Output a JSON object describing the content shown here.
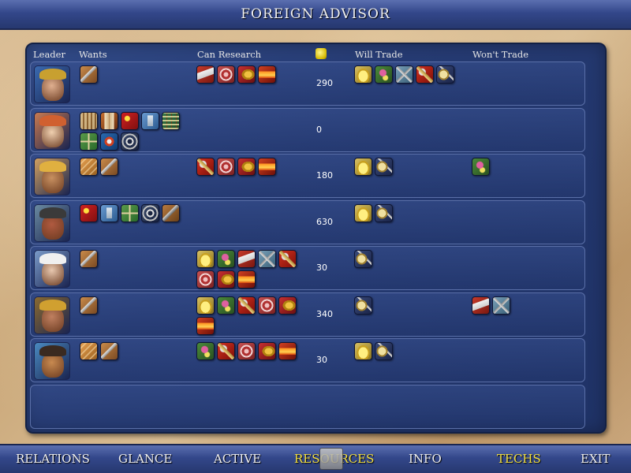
{
  "title": "FOREIGN ADVISOR",
  "headers": {
    "leader": "Leader",
    "wants": "Wants",
    "can_research": "Can Research",
    "will_trade": "Will Trade",
    "wont_trade": "Won't Trade"
  },
  "rows": [
    {
      "gold": "290",
      "leader_colors": {
        "bg": "#3a6ab0",
        "face": "#e0b090",
        "hat": "#c8a030"
      },
      "wants": [
        "sword"
      ],
      "can_research": [
        "tools-scroll",
        "target",
        "horn",
        "fire"
      ],
      "will_trade": [
        "crown",
        "flower",
        "tools",
        "hammer",
        "compass"
      ],
      "wont_trade": []
    },
    {
      "gold": "0",
      "leader_colors": {
        "bg": "#c87a50",
        "face": "#f0d0b0",
        "hat": "#d06030"
      },
      "wants": [
        "scroll",
        "book",
        "flag",
        "statue",
        "abacus",
        "map",
        "eye",
        "wheel"
      ],
      "can_research": [],
      "will_trade": [],
      "wont_trade": []
    },
    {
      "gold": "180",
      "leader_colors": {
        "bg": "#d0a060",
        "face": "#c89060",
        "hat": "#e0b040"
      },
      "wants": [
        "bronze",
        "sword"
      ],
      "can_research": [
        "hammer",
        "target",
        "horn",
        "fire"
      ],
      "will_trade": [
        "crown",
        "compass"
      ],
      "wont_trade": [
        "flower"
      ]
    },
    {
      "gold": "630",
      "leader_colors": {
        "bg": "#6a8aa0",
        "face": "#b05a40",
        "hat": "#3a3a3a"
      },
      "wants": [
        "flag",
        "statue",
        "map",
        "wheel",
        "brush"
      ],
      "can_research": [],
      "will_trade": [
        "crown",
        "compass"
      ],
      "wont_trade": []
    },
    {
      "gold": "30",
      "leader_colors": {
        "bg": "#7a9ac8",
        "face": "#e8c8b0",
        "hat": "#f0f0f0"
      },
      "wants": [
        "sword"
      ],
      "can_research": [
        "crown",
        "flower",
        "tools-scroll",
        "tools",
        "hammer",
        "target",
        "horn",
        "fire"
      ],
      "will_trade": [
        "compass"
      ],
      "wont_trade": []
    },
    {
      "gold": "340",
      "leader_colors": {
        "bg": "#8a6a30",
        "face": "#c08060",
        "hat": "#d0a030"
      },
      "wants": [
        "sword"
      ],
      "can_research": [
        "crown",
        "flower",
        "hammer",
        "target",
        "horn",
        "fire"
      ],
      "will_trade": [
        "compass"
      ],
      "wont_trade": [
        "tools-scroll",
        "tools"
      ]
    },
    {
      "gold": "30",
      "leader_colors": {
        "bg": "#4a8ac0",
        "face": "#c88a50",
        "hat": "#3a2a20"
      },
      "wants": [
        "bronze",
        "sword"
      ],
      "can_research": [
        "flower",
        "hammer",
        "target",
        "horn",
        "fire"
      ],
      "will_trade": [
        "crown",
        "compass"
      ],
      "wont_trade": []
    }
  ],
  "nav": {
    "relations": "RELATIONS",
    "glance": "GLANCE",
    "active": "ACTIVE",
    "resources": "RESOURCES",
    "info": "INFO",
    "techs": "TECHS",
    "exit": "EXIT"
  },
  "colors": {
    "accent_active": "#f4e040",
    "panel": "#263b73",
    "title_bar": "#33478a"
  }
}
